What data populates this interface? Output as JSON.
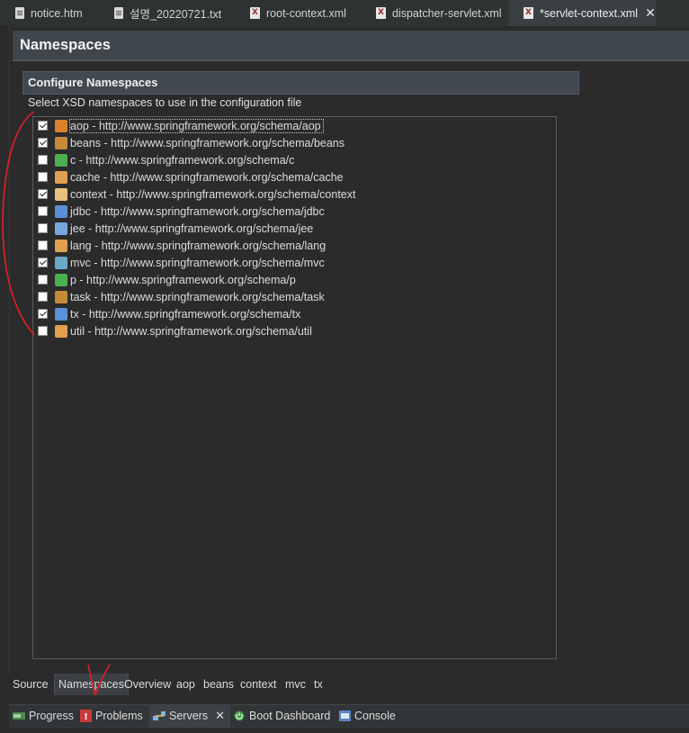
{
  "editor_tabs": [
    {
      "label": "notice.htm",
      "icon": "text-file-icon"
    },
    {
      "label": "설명_20220721.txt",
      "icon": "text-file-icon"
    },
    {
      "label": "root-context.xml",
      "icon": "xml-file-icon"
    },
    {
      "label": "dispatcher-servlet.xml",
      "icon": "xml-file-icon"
    },
    {
      "label": "*servlet-context.xml",
      "icon": "xml-file-icon",
      "active": true
    }
  ],
  "page": {
    "title": "Namespaces"
  },
  "section": {
    "title": "Configure Namespaces",
    "description": "Select XSD namespaces to use in the configuration file"
  },
  "namespaces": [
    {
      "label": "aop - http://www.springframework.org/schema/aop",
      "checked": true,
      "icon_color": "#d9822b"
    },
    {
      "label": "beans - http://www.springframework.org/schema/beans",
      "checked": true,
      "icon_color": "#c58a3a"
    },
    {
      "label": "c - http://www.springframework.org/schema/c",
      "checked": false,
      "icon_color": "#4caf50"
    },
    {
      "label": "cache - http://www.springframework.org/schema/cache",
      "checked": false,
      "icon_color": "#e0a050"
    },
    {
      "label": "context - http://www.springframework.org/schema/context",
      "checked": true,
      "icon_color": "#e8c080"
    },
    {
      "label": "jdbc - http://www.springframework.org/schema/jdbc",
      "checked": false,
      "icon_color": "#5b8fd6"
    },
    {
      "label": "jee - http://www.springframework.org/schema/jee",
      "checked": false,
      "icon_color": "#7aa6e0"
    },
    {
      "label": "lang - http://www.springframework.org/schema/lang",
      "checked": false,
      "icon_color": "#e0a050"
    },
    {
      "label": "mvc - http://www.springframework.org/schema/mvc",
      "checked": true,
      "icon_color": "#6aa9c8"
    },
    {
      "label": "p - http://www.springframework.org/schema/p",
      "checked": false,
      "icon_color": "#4caf50"
    },
    {
      "label": "task - http://www.springframework.org/schema/task",
      "checked": false,
      "icon_color": "#c58a3a"
    },
    {
      "label": "tx - http://www.springframework.org/schema/tx",
      "checked": true,
      "icon_color": "#5b8fd6"
    },
    {
      "label": "util - http://www.springframework.org/schema/util",
      "checked": false,
      "icon_color": "#e0a050"
    }
  ],
  "page_tabs": [
    "Source",
    "Namespaces",
    "Overview",
    "aop",
    "beans",
    "context",
    "mvc",
    "tx"
  ],
  "active_page_tab": "Namespaces",
  "view_tabs": [
    {
      "label": "Progress",
      "icon": "progress-icon"
    },
    {
      "label": "Problems",
      "icon": "problems-icon"
    },
    {
      "label": "Servers",
      "icon": "servers-icon",
      "active": true
    },
    {
      "label": "Boot Dashboard",
      "icon": "boot-dashboard-icon"
    },
    {
      "label": "Console",
      "icon": "console-icon"
    }
  ],
  "colors": {
    "annotation": "#e02020",
    "background": "#2b2b2b",
    "header": "#3f464c"
  }
}
